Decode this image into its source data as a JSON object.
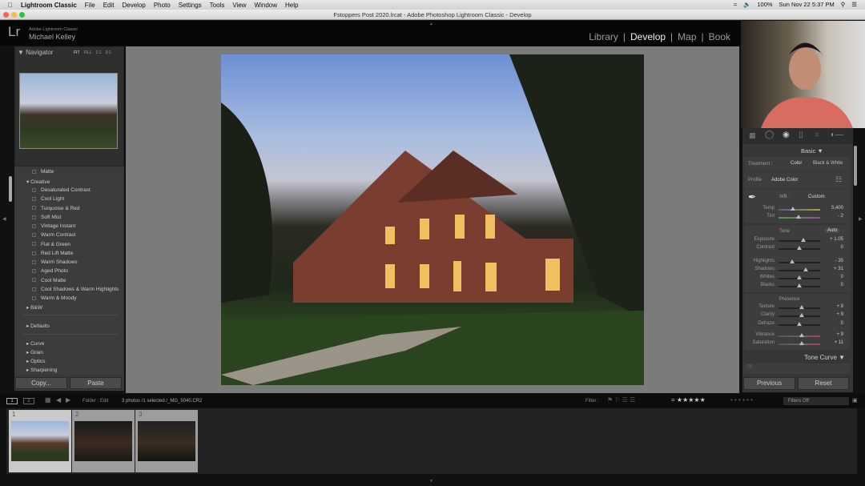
{
  "menubar": {
    "app": "Lightroom Classic",
    "items": [
      "File",
      "Edit",
      "Develop",
      "Photo",
      "Settings",
      "Tools",
      "View",
      "Window",
      "Help"
    ],
    "battery": "100%",
    "datetime": "Sun Nov 22  5:37 PM"
  },
  "window_title": "Fstoppers Post 2020.lrcat - Adobe Photoshop Lightroom Classic - Develop",
  "identity": {
    "logo": "Lr",
    "product": "Adobe Lightroom Classic",
    "user": "Michael Kelley"
  },
  "modules": [
    {
      "label": "Library",
      "active": false
    },
    {
      "label": "Develop",
      "active": true
    },
    {
      "label": "Map",
      "active": false
    },
    {
      "label": "Book",
      "active": false
    }
  ],
  "navigator": {
    "title": "Navigator",
    "zoom": [
      "FIT",
      "FILL",
      "1:1",
      "3:1"
    ]
  },
  "presets": {
    "top_item": "Matte",
    "group": "Creative",
    "items": [
      "Desaturated Contrast",
      "Cool Light",
      "Turquoise & Red",
      "Soft Mist",
      "Vintage Instant",
      "Warm Contrast",
      "Flat & Green",
      "Red Lift Matte",
      "Warm Shadows",
      "Aged Photo",
      "Cool Matte",
      "Cool Shadows & Warm Highlights",
      "Warm & Moody"
    ],
    "groups_after": [
      "B&W"
    ],
    "defaults": "Defaults",
    "more": [
      "Curve",
      "Grain",
      "Optics",
      "Sharpening"
    ]
  },
  "left_buttons": {
    "copy": "Copy...",
    "paste": "Paste"
  },
  "basic": {
    "title": "Basic",
    "treatment_label": "Treatment :",
    "treatment_color": "Color",
    "treatment_bw": "Black & White",
    "profile_label": "Profile :",
    "profile": "Adobe Color",
    "wb_label": "WB :",
    "wb": "Custom",
    "tone_label": "Tone",
    "auto": "Auto",
    "presence_label": "Presence",
    "sliders": [
      {
        "label": "Temp",
        "value": "5,400",
        "pos": 0.35
      },
      {
        "label": "Tint",
        "value": "- 2",
        "pos": 0.48
      },
      {
        "label": "Exposure",
        "value": "+ 1.05",
        "pos": 0.6
      },
      {
        "label": "Contrast",
        "value": "0",
        "pos": 0.5
      },
      {
        "label": "Highlights",
        "value": "- 35",
        "pos": 0.33
      },
      {
        "label": "Shadows",
        "value": "+ 31",
        "pos": 0.65
      },
      {
        "label": "Whites",
        "value": "0",
        "pos": 0.5
      },
      {
        "label": "Blacks",
        "value": "0",
        "pos": 0.5
      },
      {
        "label": "Texture",
        "value": "+ 9",
        "pos": 0.55
      },
      {
        "label": "Clarity",
        "value": "+ 9",
        "pos": 0.55
      },
      {
        "label": "Dehaze",
        "value": "0",
        "pos": 0.5
      },
      {
        "label": "Vibrance",
        "value": "+ 9",
        "pos": 0.55
      },
      {
        "label": "Saturation",
        "value": "+ 11",
        "pos": 0.56
      }
    ]
  },
  "tone_curve": {
    "title": "Tone Curve"
  },
  "right_buttons": {
    "previous": "Previous",
    "reset": "Reset"
  },
  "filmstrip": {
    "view1": "1",
    "view2": "2",
    "source": "Folder : Edit",
    "info": "3 photos /1 selected /_MG_5040.CR2",
    "filter_label": "Filter :",
    "filters": "Filters Off",
    "stars": 5,
    "cells": [
      "1",
      "2",
      "3"
    ]
  }
}
